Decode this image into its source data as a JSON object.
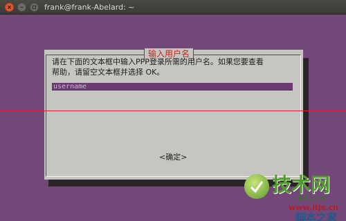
{
  "window": {
    "title": "frank@frank-Abelard: ~",
    "buttons": {
      "close_icon": "close-icon",
      "minimize_icon": "minimize-icon",
      "maximize_icon": "maximize-icon"
    }
  },
  "dialog": {
    "title": "输入用户名",
    "prompt_line1": "请在下面的文本框中输入PPP登录所需的用户名。如果您要查看",
    "prompt_line2": "帮助，请留空文本框并选择 OK。",
    "input_value": "username",
    "ok_label": "<确定>"
  },
  "watermark": {
    "big": "技术网",
    "site": "jb51.net",
    "url": "www.itjs.cn",
    "sub": "脚本之家"
  },
  "colors": {
    "terminal_bg": "#734878",
    "dialog_bg": "#c6c5c2",
    "dialog_title": "#c4271c",
    "input_bg": "#6a3b70",
    "close_button": "#e0552d",
    "red_line": "#e0202a"
  }
}
